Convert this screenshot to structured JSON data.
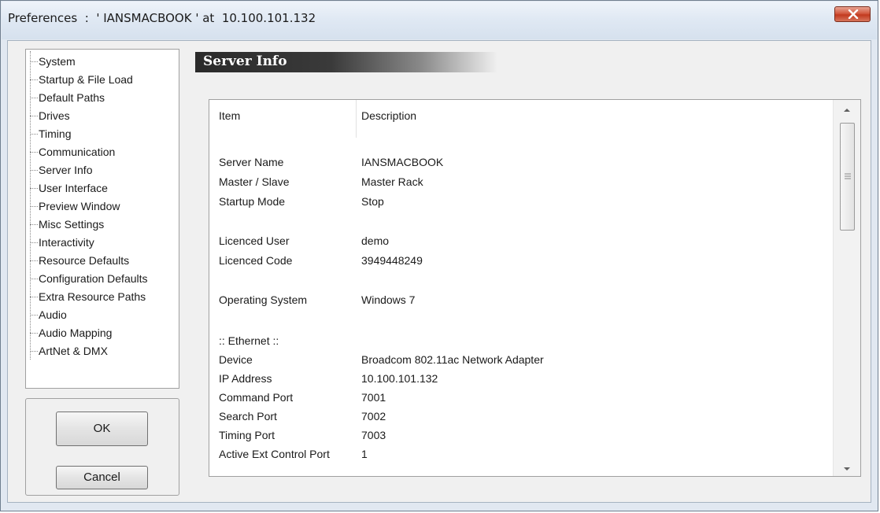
{
  "window": {
    "title": "Preferences  :  ' IANSMACBOOK ' at  10.100.101.132",
    "close_icon": "close-icon"
  },
  "tree": {
    "items": [
      {
        "label": "System"
      },
      {
        "label": "Startup & File Load"
      },
      {
        "label": "Default Paths"
      },
      {
        "label": "Drives"
      },
      {
        "label": "Timing"
      },
      {
        "label": "Communication"
      },
      {
        "label": "Server Info"
      },
      {
        "label": "User Interface"
      },
      {
        "label": "Preview Window"
      },
      {
        "label": "Misc Settings"
      },
      {
        "label": "Interactivity"
      },
      {
        "label": "Resource Defaults"
      },
      {
        "label": "Configuration Defaults"
      },
      {
        "label": "Extra Resource Paths"
      },
      {
        "label": "Audio"
      },
      {
        "label": "Audio Mapping"
      },
      {
        "label": "ArtNet & DMX"
      }
    ]
  },
  "buttons": {
    "ok": "OK",
    "cancel": "Cancel"
  },
  "section": {
    "title": "Server Info"
  },
  "list": {
    "columns": [
      "Item",
      "Description"
    ],
    "rows": [
      {
        "item": "Server Name",
        "desc": "IANSMACBOOK"
      },
      {
        "item": "Master / Slave",
        "desc": "Master Rack"
      },
      {
        "item": "Startup Mode",
        "desc": "Stop"
      },
      {
        "item": "Licenced User",
        "desc": "demo"
      },
      {
        "item": "Licenced Code",
        "desc": "3949448249"
      },
      {
        "item": "Operating System",
        "desc": "Windows 7"
      },
      {
        "item": ":: Ethernet ::",
        "desc": ""
      },
      {
        "item": "Device",
        "desc": "Broadcom 802.11ac Network Adapter"
      },
      {
        "item": "IP Address",
        "desc": "10.100.101.132"
      },
      {
        "item": "Command Port",
        "desc": "7001"
      },
      {
        "item": "Search Port",
        "desc": "7002"
      },
      {
        "item": "Timing Port",
        "desc": "7003"
      },
      {
        "item": "Active Ext Control Port",
        "desc": "1"
      }
    ]
  }
}
